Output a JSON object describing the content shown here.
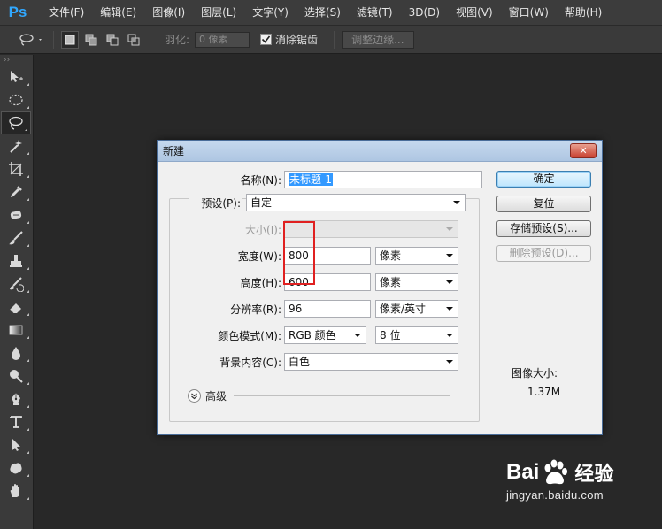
{
  "app": {
    "logo": "Ps"
  },
  "menu": [
    "文件(F)",
    "编辑(E)",
    "图像(I)",
    "图层(L)",
    "文字(Y)",
    "选择(S)",
    "滤镜(T)",
    "3D(D)",
    "视图(V)",
    "窗口(W)",
    "帮助(H)"
  ],
  "options": {
    "feather_label": "羽化:",
    "feather_value": "0 像素",
    "antialias_label": "消除锯齿",
    "antialias_checked": true,
    "refine_label": "调整边缘..."
  },
  "toolbox": {
    "grip": "››",
    "tools": [
      "move-tool",
      "elliptical-marquee-tool",
      "lasso-tool",
      "magic-wand-tool",
      "crop-tool",
      "eyedropper-tool",
      "spot-healing-tool",
      "brush-tool",
      "clone-stamp-tool",
      "history-brush-tool",
      "eraser-tool",
      "gradient-tool",
      "blur-tool",
      "dodge-tool",
      "pen-tool",
      "type-tool",
      "path-selection-tool",
      "custom-shape-tool",
      "hand-tool"
    ],
    "active": "lasso-tool"
  },
  "dialog": {
    "title": "新建",
    "close": "✕",
    "name_label": "名称(N):",
    "name_value": "未标题-1",
    "preset_label": "预设(P):",
    "preset_value": "自定",
    "size_label": "大小(I):",
    "size_value": "",
    "width_label": "宽度(W):",
    "width_value": "800",
    "width_unit": "像素",
    "height_label": "高度(H):",
    "height_value": "600",
    "height_unit": "像素",
    "resolution_label": "分辨率(R):",
    "resolution_value": "96",
    "resolution_unit": "像素/英寸",
    "color_mode_label": "颜色模式(M):",
    "color_mode_value": "RGB 颜色",
    "bit_depth_value": "8 位",
    "background_label": "背景内容(C):",
    "background_value": "白色",
    "advanced_label": "高级",
    "image_size_label": "图像大小:",
    "image_size_value": "1.37M",
    "buttons": {
      "ok": "确定",
      "reset": "复位",
      "save_preset": "存储预设(S)...",
      "delete_preset": "删除预设(D)..."
    }
  },
  "watermark": {
    "logo_left": "Bai",
    "logo_right": "经验",
    "url": "jingyan.baidu.com"
  },
  "colors": {
    "workspace": "#282828",
    "panel": "#3a3a3a",
    "selection": "#3399ff",
    "highlight": "#e02020"
  }
}
